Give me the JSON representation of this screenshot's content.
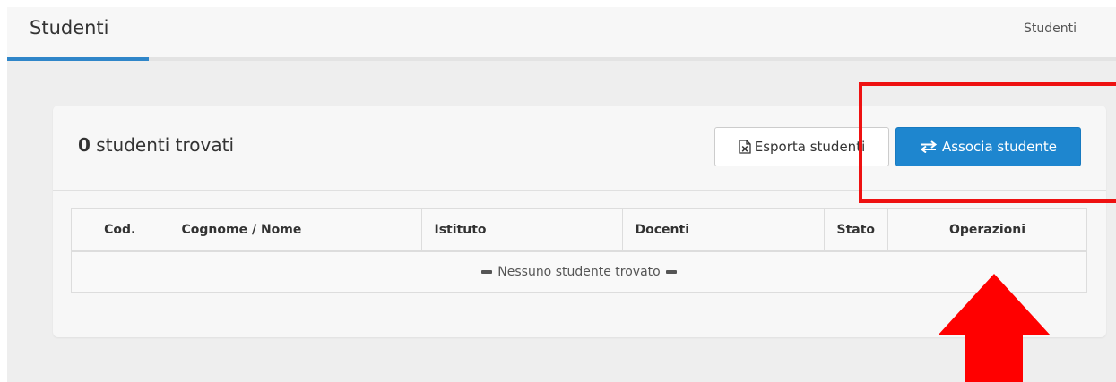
{
  "header": {
    "title": "Studenti",
    "breadcrumb": "Studenti"
  },
  "panel": {
    "count": "0",
    "count_label": " studenti trovati",
    "export_button": {
      "label": "Esporta studenti",
      "icon": "excel-file-icon"
    },
    "associate_button": {
      "label": "Associa studente",
      "icon": "exchange-arrows-icon"
    }
  },
  "table": {
    "columns": [
      "Cod.",
      "Cognome / Nome",
      "Istituto",
      "Docenti",
      "Stato",
      "Operazioni"
    ],
    "empty_message": "Nessuno studente trovato"
  },
  "annotations": {
    "highlight_color": "#ee1111",
    "arrow_color": "#ff0000"
  },
  "colors": {
    "primary": "#1e86cf",
    "tab_underline": "#2f86c9"
  }
}
